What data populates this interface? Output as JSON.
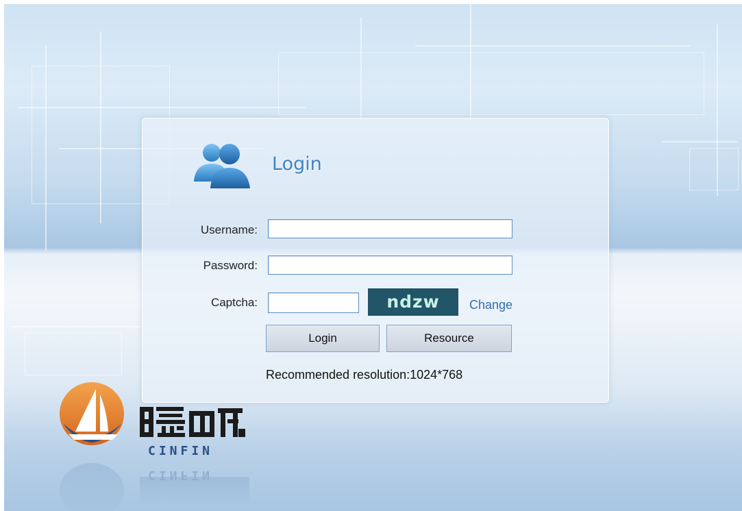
{
  "login": {
    "title": "Login",
    "username_label": "Username:",
    "password_label": "Password:",
    "captcha_label": "Captcha:",
    "username_value": "",
    "password_value": "",
    "captcha_value": "",
    "captcha_text": "ndzw",
    "change_link": "Change",
    "login_button": "Login",
    "resource_button": "Resource",
    "resolution_note": "Recommended resolution:1024*768"
  },
  "brand": {
    "chinese_name": "曦帆",
    "latin_name": "CINFIN",
    "primary_color": "#e07a2a",
    "secondary_color": "#2a4f86"
  },
  "colors": {
    "title": "#3f83c2",
    "link": "#2f6db0",
    "captcha_bg": "#215567",
    "input_border": "#5b8fc9"
  },
  "icons": [
    "users-icon",
    "company-logo"
  ]
}
